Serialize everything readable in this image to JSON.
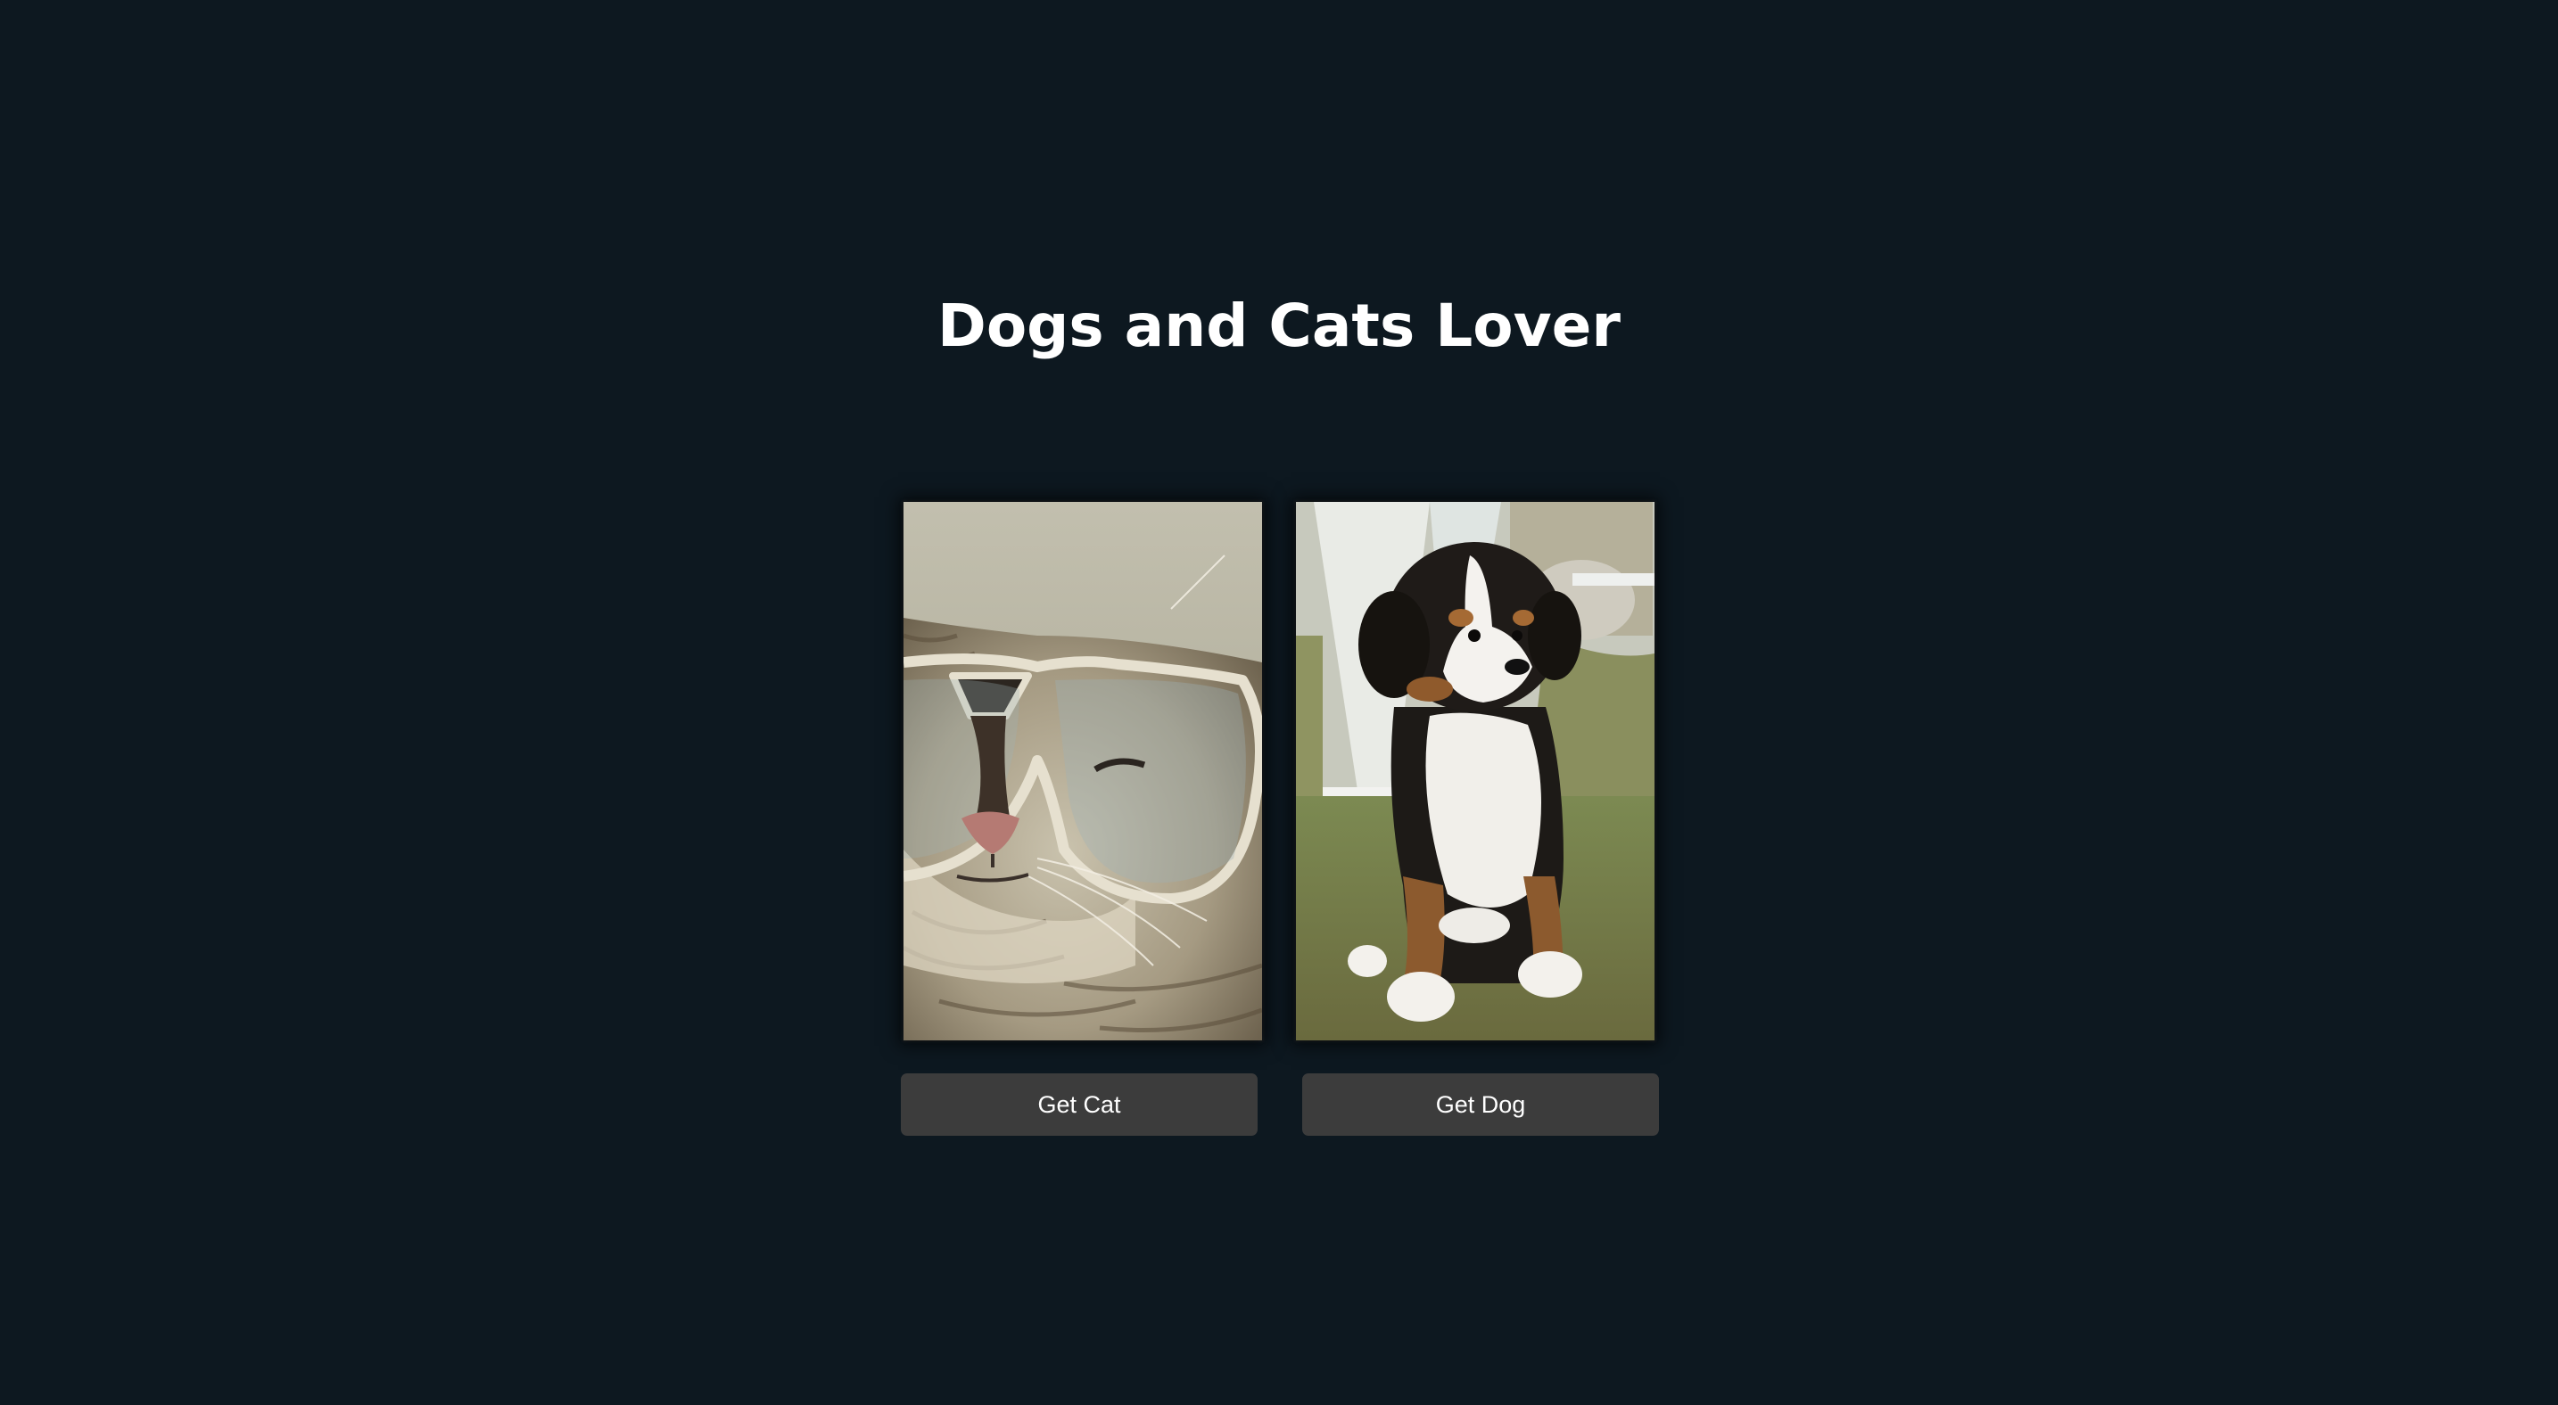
{
  "page": {
    "title": "Dogs and Cats Lover"
  },
  "cards": {
    "cat": {
      "image": "cat-with-glasses-photo"
    },
    "dog": {
      "image": "puppy-photo"
    }
  },
  "buttons": {
    "cat_label": "Get Cat",
    "dog_label": "Get Dog"
  },
  "colors": {
    "background": "#0d1820",
    "button": "#3c3c3c",
    "text": "#ffffff"
  }
}
